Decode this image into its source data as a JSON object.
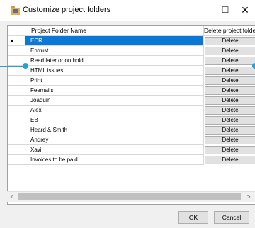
{
  "window": {
    "title": "Customize project folders",
    "minimize_glyph": "—",
    "maximize_glyph": "☐",
    "close_glyph": "✕"
  },
  "grid": {
    "columns": [
      "Project Folder Name",
      "Delete project folder"
    ],
    "rows": [
      {
        "name": "ECR",
        "action": "Delete"
      },
      {
        "name": "Entrust",
        "action": "Delete"
      },
      {
        "name": "Read later or on hold",
        "action": "Delete"
      },
      {
        "name": "HTML issues",
        "action": "Delete"
      },
      {
        "name": "Print",
        "action": "Delete"
      },
      {
        "name": "Feemails",
        "action": "Delete"
      },
      {
        "name": "Joaquín",
        "action": "Delete"
      },
      {
        "name": "Alex",
        "action": "Delete"
      },
      {
        "name": "EB",
        "action": "Delete"
      },
      {
        "name": "Heard & Smith",
        "action": "Delete"
      },
      {
        "name": "Andrey",
        "action": "Delete"
      },
      {
        "name": "Xavi",
        "action": "Delete"
      },
      {
        "name": "Invoices to be paid",
        "action": "Delete"
      }
    ]
  },
  "scrollbar": {
    "left_glyph": "<",
    "right_glyph": ">"
  },
  "buttons": {
    "ok": "OK",
    "cancel": "Cancel"
  }
}
